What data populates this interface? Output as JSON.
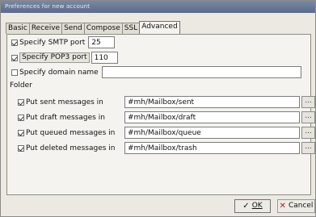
{
  "window": {
    "title": "Preferences for new account"
  },
  "tabs": [
    {
      "label": "Basic"
    },
    {
      "label": "Receive"
    },
    {
      "label": "Send"
    },
    {
      "label": "Compose"
    },
    {
      "label": "SSL"
    },
    {
      "label": "Advanced",
      "active": true
    }
  ],
  "advanced": {
    "smtp": {
      "label": "Specify SMTP port",
      "checked": true,
      "value": "25"
    },
    "pop3": {
      "label": "Specify POP3 port",
      "checked": true,
      "value": "110"
    },
    "domain": {
      "label": "Specify domain name",
      "checked": false,
      "value": ""
    }
  },
  "folder": {
    "title": "Folder",
    "browse_label": "...",
    "rows": [
      {
        "label": "Put sent messages in",
        "checked": true,
        "value": "#mh/Mailbox/sent"
      },
      {
        "label": "Put draft messages in",
        "checked": true,
        "value": "#mh/Mailbox/draft"
      },
      {
        "label": "Put queued messages in",
        "checked": true,
        "value": "#mh/Mailbox/queue"
      },
      {
        "label": "Put deleted messages in",
        "checked": true,
        "value": "#mh/Mailbox/trash"
      }
    ]
  },
  "buttons": {
    "ok": {
      "label": "OK",
      "icon": "ok-icon"
    },
    "cancel": {
      "label": "Cancel",
      "icon": "cancel-icon"
    }
  }
}
